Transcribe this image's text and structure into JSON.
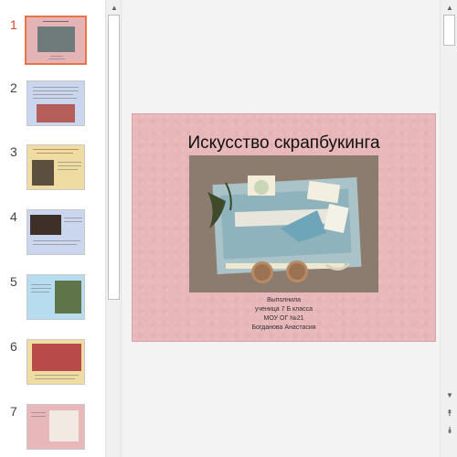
{
  "thumbnails": [
    {
      "number": "1",
      "active": true
    },
    {
      "number": "2",
      "active": false
    },
    {
      "number": "3",
      "active": false
    },
    {
      "number": "4",
      "active": false
    },
    {
      "number": "5",
      "active": false
    },
    {
      "number": "6",
      "active": false
    },
    {
      "number": "7",
      "active": false
    }
  ],
  "slide": {
    "title": "Искусство скрапбукинга",
    "caption_lines": [
      "Выполнила",
      "ученица 7 Б класса",
      "МОУ ОГ №21",
      "Богданова Анастасия"
    ]
  },
  "scrollbars": {
    "up_arrow": "▲",
    "down_arrow": "▼",
    "prev_slide": "⯭",
    "next_slide": "⯯"
  },
  "colors": {
    "active_number": "#d24726",
    "active_border": "#e8754a",
    "slide_background": "#e8b7b9"
  }
}
